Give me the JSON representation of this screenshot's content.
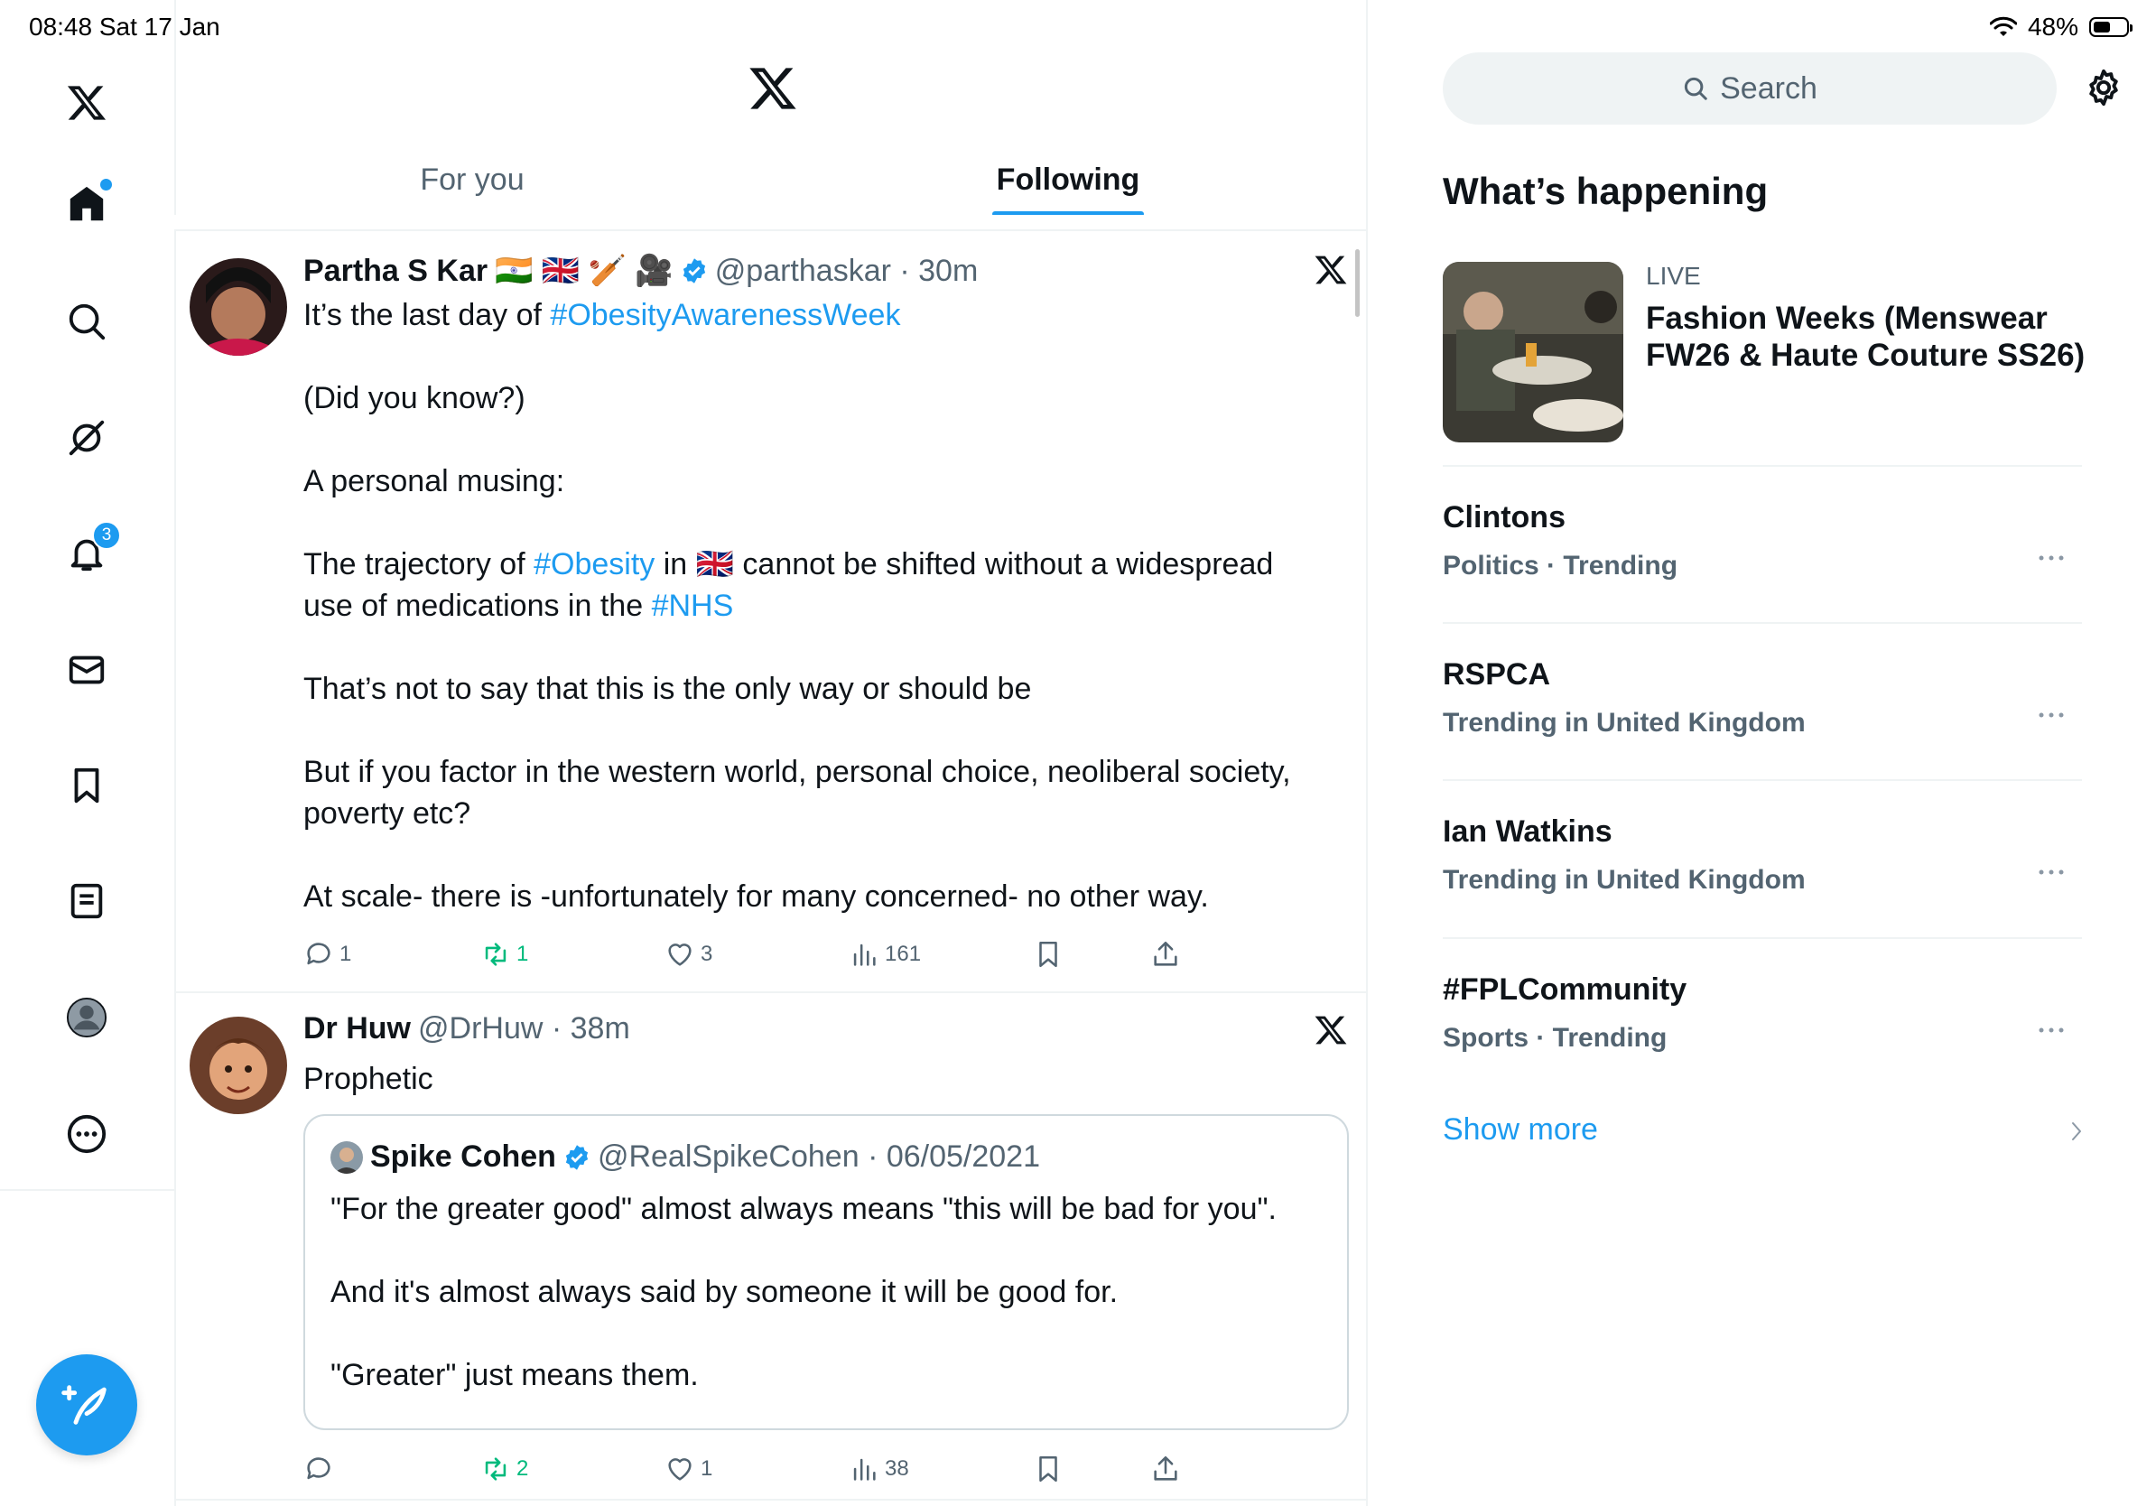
{
  "status": {
    "time_date": "08:48  Sat 17 Jan",
    "battery": "48%"
  },
  "nav": {
    "items": [
      "X home logo",
      "Home",
      "Search",
      "Grok",
      "Notifications",
      "Messages",
      "Bookmarks",
      "Lists",
      "Profile",
      "More"
    ],
    "notifications_badge": "3"
  },
  "colors": {
    "accent": "#1d9bf0",
    "repost_green": "#00ba7c",
    "muted": "#536471"
  },
  "tabs": {
    "for_you": "For you",
    "following": "Following"
  },
  "tweets": [
    {
      "name": "Partha S Kar",
      "name_emojis": "🇮🇳 🇬🇧 🏏 🎥",
      "handle_time": "@parthaskar · 30m",
      "line1_prefix": "It’s the last day of ",
      "line1_tag": "#ObesityAwarenessWeek",
      "p2": "(Did you know?)",
      "p3": "A personal musing:",
      "p4_a": "The trajectory of ",
      "p4_tag1": "#Obesity",
      "p4_b": " in 🇬🇧 cannot be shifted without a widespread use of medications in the ",
      "p4_tag2": "#NHS",
      "p5": "That’s not to say that this is the only way or should be",
      "p6": "But if you factor in the western world, personal choice, neoliberal society, poverty etc?",
      "p7": "At scale- there is -unfortunately for many concerned- no other way.",
      "replies": "1",
      "reposts": "1",
      "likes": "3",
      "views": "161"
    },
    {
      "name": "Dr Huw",
      "handle_time": "@DrHuw · 38m",
      "text": "Prophetic",
      "quote": {
        "name": "Spike Cohen",
        "handle_time": "@RealSpikeCohen · 06/05/2021",
        "p1": "\"For the greater good\" almost always means \"this will be bad for you\".",
        "p2": "And it's almost always said by someone it will be good for.",
        "p3": "\"Greater\" just means them."
      },
      "replies": "",
      "reposts": "2",
      "likes": "1",
      "views": "38"
    }
  ],
  "right": {
    "search_placeholder": "Search",
    "title": "What’s happening",
    "live": {
      "label": "LIVE",
      "title": "Fashion Weeks (Menswear FW26 & Haute Couture SS26)"
    },
    "trends": [
      {
        "name": "Clintons",
        "meta": "Politics · Trending"
      },
      {
        "name": "RSPCA",
        "meta": "Trending in United Kingdom"
      },
      {
        "name": "Ian Watkins",
        "meta": "Trending in United Kingdom"
      },
      {
        "name": "#FPLCommunity",
        "meta": "Sports · Trending"
      }
    ],
    "show_more": "Show more"
  }
}
